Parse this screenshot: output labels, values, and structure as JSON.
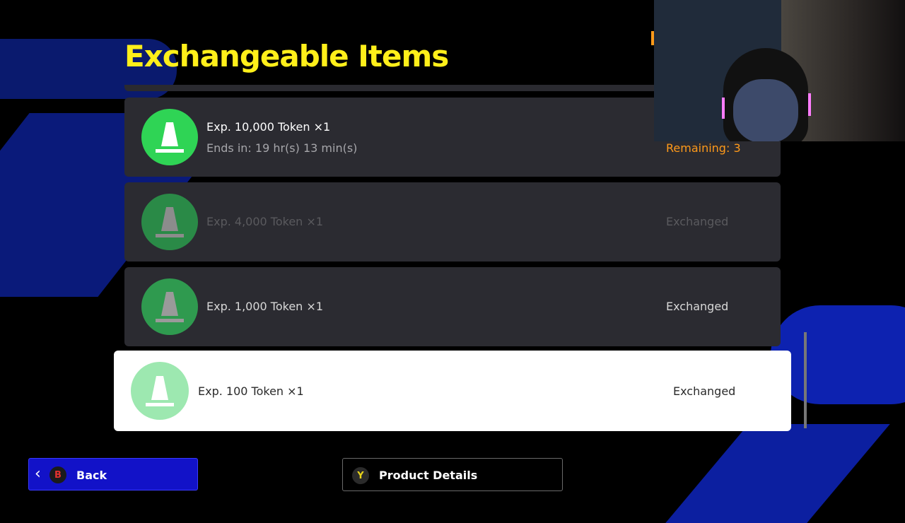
{
  "screen": {
    "title": "Exchangeable Items"
  },
  "items": [
    {
      "name": "Exp. 10,000 Token ×1",
      "sub": "Ends in: 19 hr(s) 13 min(s)",
      "status": "Remaining: 3",
      "icon": "cone-icon"
    },
    {
      "name": "Exp. 4,000 Token ×1",
      "status": "Exchanged",
      "icon": "cone-icon"
    },
    {
      "name": "Exp. 1,000 Token ×1",
      "status": "Exchanged",
      "icon": "cone-icon"
    },
    {
      "name": "Exp. 100 Token ×1",
      "status": "Exchanged",
      "icon": "cone-icon",
      "selected": true
    }
  ],
  "footer": {
    "back_button": {
      "glyph": "B",
      "label": "Back"
    },
    "details_button": {
      "glyph": "Y",
      "label": "Product Details"
    }
  },
  "colors": {
    "title": "#ffef1a",
    "remaining": "#ff9a1a",
    "accent_blue": "#1212c8"
  }
}
